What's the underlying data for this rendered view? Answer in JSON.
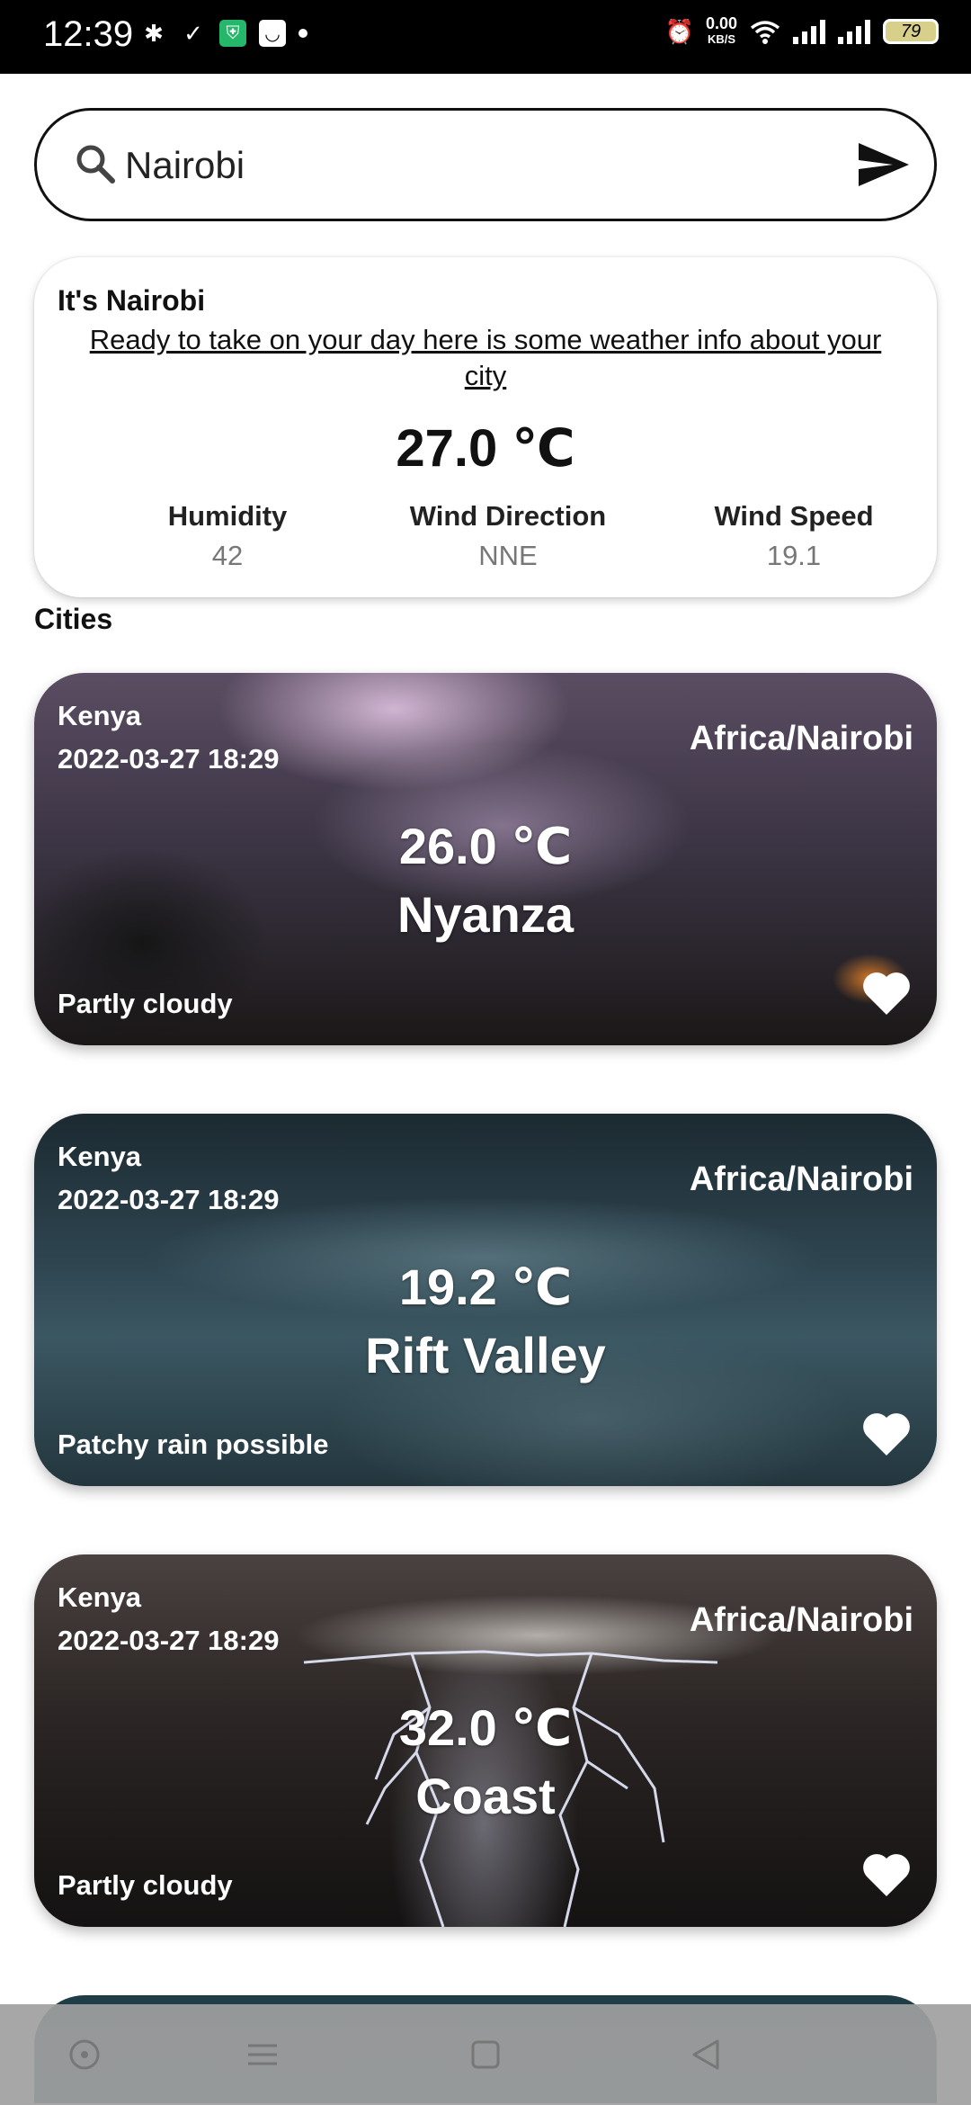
{
  "status_bar": {
    "time": "12:39",
    "net_speed_value": "0.00",
    "net_speed_unit": "KB/S",
    "battery": "79"
  },
  "search": {
    "value": "Nairobi",
    "icons": [
      "search-icon",
      "send-icon"
    ]
  },
  "current": {
    "heading": "It's Nairobi",
    "subtitle": "Ready to take on your day here is some weather info about your city",
    "temperature": "27.0 ℃",
    "humidity_label": "Humidity",
    "humidity_value": "42",
    "wind_direction_label": "Wind Direction",
    "wind_direction_value": "NNE",
    "wind_speed_label": "Wind Speed",
    "wind_speed_value": "19.1"
  },
  "cities_title": "Cities",
  "cities": [
    {
      "country": "Kenya",
      "datetime": "2022-03-27 18:29",
      "timezone": "Africa/Nairobi",
      "temperature": "26.0 ℃",
      "name": "Nyanza",
      "condition": "Partly cloudy"
    },
    {
      "country": "Kenya",
      "datetime": "2022-03-27 18:29",
      "timezone": "Africa/Nairobi",
      "temperature": "19.2 ℃",
      "name": "Rift Valley",
      "condition": "Patchy rain possible"
    },
    {
      "country": "Kenya",
      "datetime": "2022-03-27 18:29",
      "timezone": "Africa/Nairobi",
      "temperature": "32.0 ℃",
      "name": "Coast",
      "condition": "Partly cloudy"
    }
  ],
  "colors": {
    "card_text": "#ffffff",
    "stat_value": "#777777",
    "nav_bar": "#a0a0a0"
  }
}
